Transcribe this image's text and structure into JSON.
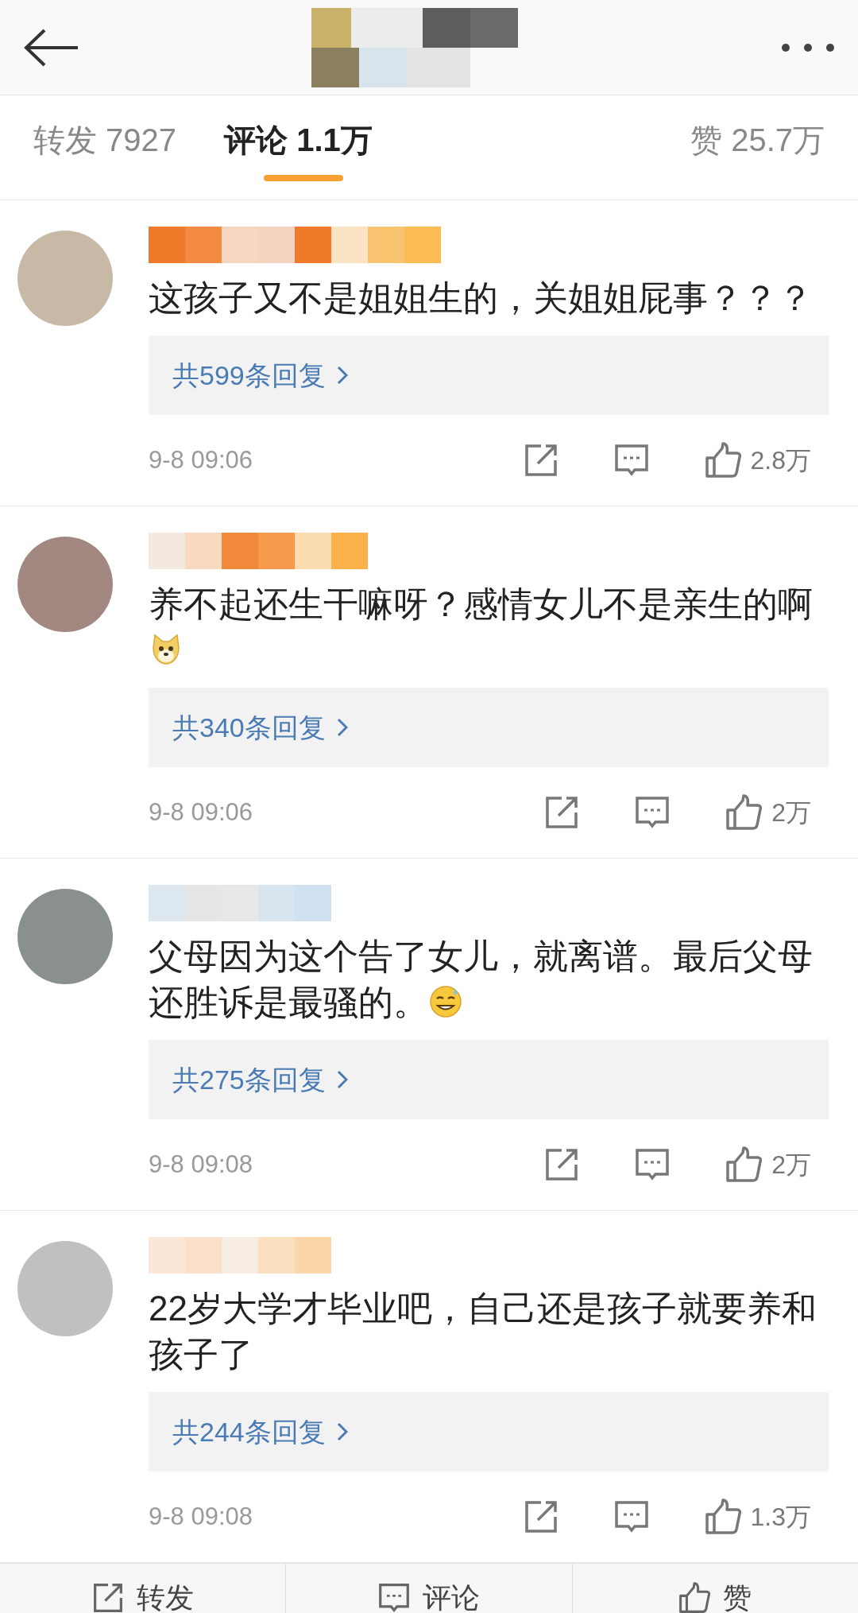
{
  "tabs": [
    {
      "label": "转发 7927",
      "selected": false
    },
    {
      "label": "评论 1.1万",
      "selected": true
    },
    {
      "label": "赞 25.7万",
      "selected": false
    }
  ],
  "comments": [
    {
      "text": "这孩子又不是姐姐生的，关姐姐屁事？？？",
      "replies": "共599条回复",
      "time": "9-8 09:06",
      "likes": "2.8万"
    },
    {
      "text": "养不起还生干嘛呀？感情女儿不是亲生的啊",
      "emoji": {
        "kind": "doge"
      },
      "replies": "共340条回复",
      "time": "9-8 09:06",
      "likes": "2万"
    },
    {
      "text": "父母因为这个告了女儿，就离谱。最后父母还胜诉是最骚的。",
      "emoji": {
        "kind": "sweat"
      },
      "replies": "共275条回复",
      "time": "9-8 09:08",
      "likes": "2万"
    },
    {
      "text": "22岁大学才毕业吧，自己还是孩子就要养和孩子了",
      "replies": "共244条回复",
      "time": "9-8 09:08",
      "likes": "1.3万"
    }
  ],
  "bottom_bar": [
    {
      "kind": "repost",
      "label": "转发"
    },
    {
      "kind": "comment",
      "label": "评论"
    },
    {
      "kind": "like",
      "label": "赞"
    }
  ]
}
